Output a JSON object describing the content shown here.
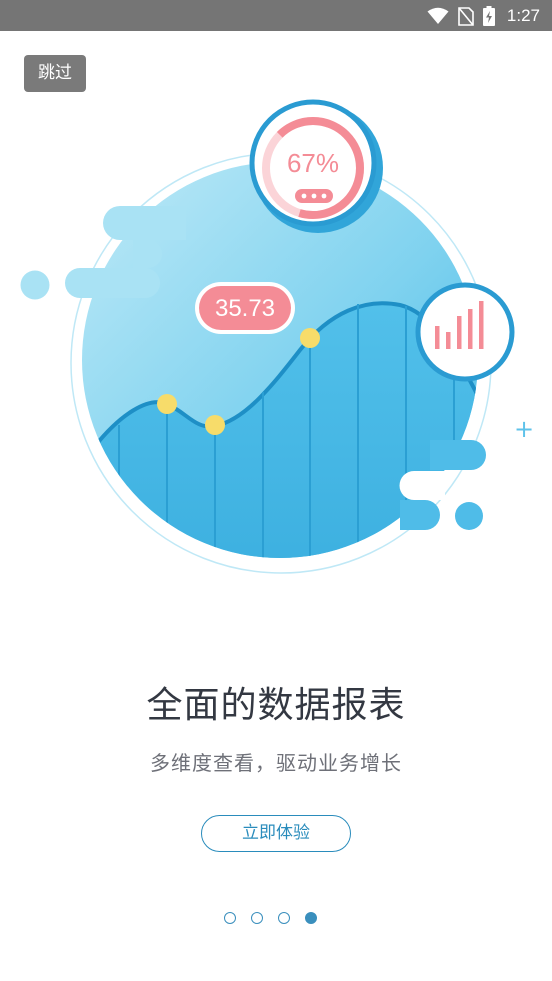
{
  "status_bar": {
    "time": "1:27",
    "icons": [
      "wifi-icon",
      "no-sim-icon",
      "battery-charging-icon"
    ]
  },
  "skip_button": {
    "label": "跳过"
  },
  "illustration": {
    "percent_gauge": {
      "label": "67%",
      "value": 0.67
    },
    "value_badge": {
      "label": "35.73"
    },
    "plus_icon": "+",
    "icons": [
      "gauge-icon",
      "bar-chart-icon",
      "plus-icon"
    ]
  },
  "headline": "全面的数据报表",
  "subline": "多维度查看，驱动业务增长",
  "cta_button": {
    "label": "立即体验"
  },
  "pager": {
    "count": 4,
    "active_index": 3
  },
  "colors": {
    "status_bar": "#757575",
    "accent": "#2a8cbc",
    "sky_light": "#a8e3f4",
    "sky": "#53c3ec",
    "chart_blue": "#2fa5d8",
    "pink": "#f48c96",
    "marker_yellow": "#f7dc6a"
  }
}
